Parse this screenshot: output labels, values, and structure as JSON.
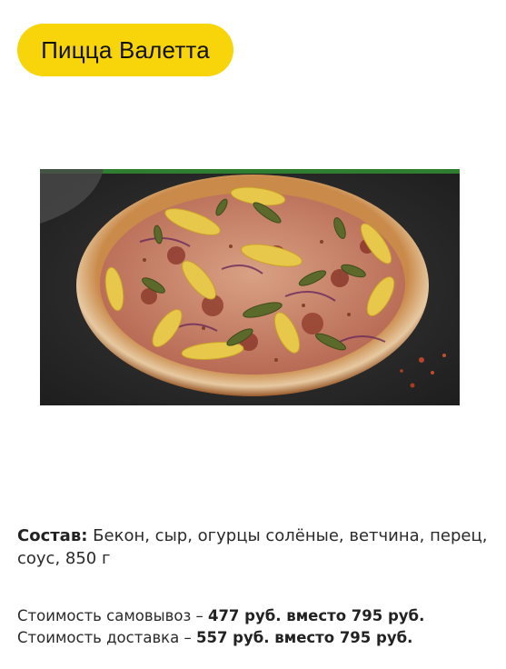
{
  "title": "Пицца Валетта",
  "image": {
    "alt": "Пицца Валетта"
  },
  "composition": {
    "label": "Состав:",
    "text": "Бекон, сыр, огурцы солёные, ветчина, перец, соус, 850 г"
  },
  "prices": {
    "pickup": {
      "label": "Стоимость самовывоз – ",
      "value": "477 руб. вместо 795 руб."
    },
    "delivery": {
      "label": "Стоимость доставка – ",
      "value": "557 руб. вместо 795 руб."
    }
  },
  "colors": {
    "title_pill": "#f8d40a",
    "text": "#2a2a2a",
    "background": "#ffffff"
  }
}
